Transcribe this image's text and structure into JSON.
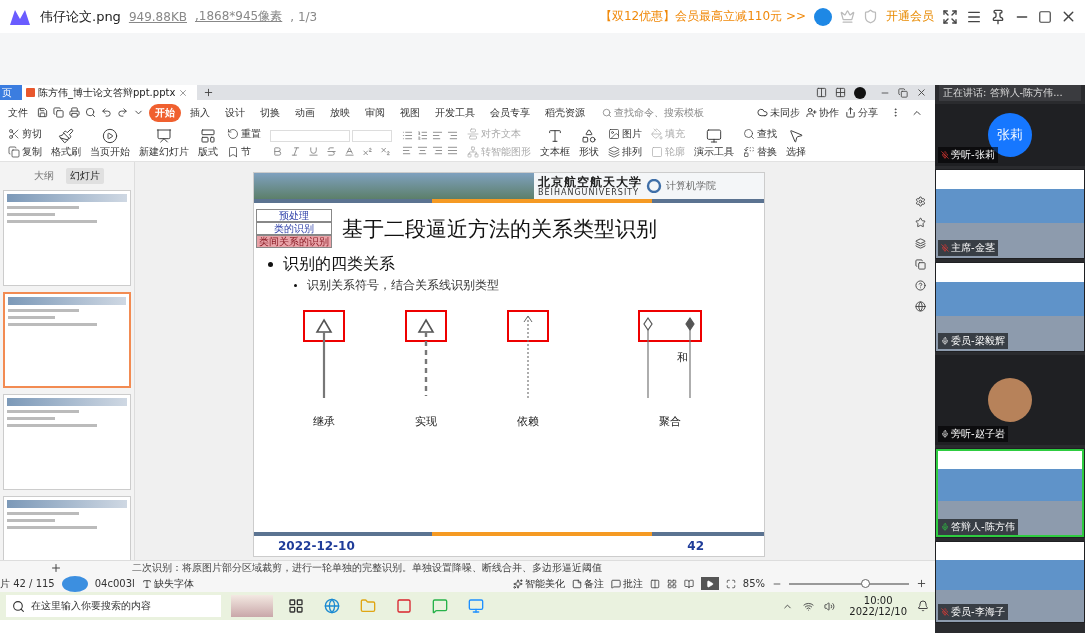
{
  "viewer": {
    "filename": "伟仔论文.png",
    "filesize": "949.88KB",
    "dimensions": ",1868*945像素",
    "position": ", 1/3",
    "promo": "【双12优惠】会员最高立减110元 >>",
    "vip_button": "开通会员"
  },
  "wps": {
    "home_tab": "页",
    "doc_tab": "陈方伟_博士论文答辩ppt.pptx",
    "menu": [
      {
        "label": "文件",
        "selected": false
      },
      {
        "label": "开始",
        "selected": true
      },
      {
        "label": "插入",
        "selected": false
      },
      {
        "label": "设计",
        "selected": false
      },
      {
        "label": "切换",
        "selected": false
      },
      {
        "label": "动画",
        "selected": false
      },
      {
        "label": "放映",
        "selected": false
      },
      {
        "label": "审阅",
        "selected": false
      },
      {
        "label": "视图",
        "selected": false
      },
      {
        "label": "开发工具",
        "selected": false
      },
      {
        "label": "会员专享",
        "selected": false
      },
      {
        "label": "稻壳资源",
        "selected": false
      }
    ],
    "search_placeholder": "查找命令、搜索模板",
    "actions": [
      "未同步",
      "协作",
      "分享"
    ],
    "ribbon": [
      {
        "kind": "stack",
        "items": [
          {
            "label": "剪切",
            "disabled": false
          },
          {
            "label": "复制",
            "disabled": false
          }
        ]
      },
      {
        "kind": "large",
        "label": "格式刷",
        "disabled": false
      },
      {
        "kind": "large",
        "label": "当页开始",
        "disabled": false
      },
      {
        "kind": "large",
        "label": "新建幻灯片",
        "disabled": false
      },
      {
        "kind": "large",
        "label": "版式",
        "disabled": false
      },
      {
        "kind": "stack",
        "items": [
          {
            "label": "重置",
            "disabled": false
          },
          {
            "label": "节",
            "disabled": false
          }
        ]
      },
      {
        "kind": "font"
      },
      {
        "kind": "paragraph"
      },
      {
        "kind": "stack",
        "items": [
          {
            "label": "对齐文本",
            "disabled": true
          },
          {
            "label": "转智能图形",
            "disabled": true
          }
        ]
      },
      {
        "kind": "large",
        "label": "文本框",
        "disabled": false
      },
      {
        "kind": "large",
        "label": "形状",
        "disabled": false
      },
      {
        "kind": "stack",
        "items": [
          {
            "label": "图片",
            "disabled": false
          },
          {
            "label": "排列",
            "disabled": false
          }
        ]
      },
      {
        "kind": "stack",
        "items": [
          {
            "label": "填充",
            "disabled": true
          },
          {
            "label": "轮廓",
            "disabled": true
          }
        ]
      },
      {
        "kind": "large",
        "label": "演示工具",
        "disabled": false
      },
      {
        "kind": "stack",
        "items": [
          {
            "label": "查找",
            "disabled": false
          },
          {
            "label": "替换",
            "disabled": false
          }
        ]
      },
      {
        "kind": "large",
        "label": "选择",
        "disabled": false
      }
    ],
    "panel_tabs": [
      {
        "label": "大纲",
        "selected": false
      },
      {
        "label": "幻灯片",
        "selected": true
      }
    ],
    "thumbnails": [
      {
        "selected": false
      },
      {
        "selected": true
      },
      {
        "selected": false
      },
      {
        "selected": false
      }
    ],
    "slide": {
      "school": "北京航空航天大学",
      "school_en": "BEIHANGUNIVERSITY",
      "college": "计算机学院",
      "nav": [
        {
          "label": "预处理",
          "selected": false
        },
        {
          "label": "类的识别",
          "selected": false
        },
        {
          "label": "类间关系的识别",
          "selected": true
        }
      ],
      "title": "基于二段逼近方法的关系类型识别",
      "bullet": "识别的四类关系",
      "sub_bullet": "识别关系符号，结合关系线识别类型",
      "figures": [
        {
          "kind": "solid-triangle",
          "label": "继承"
        },
        {
          "kind": "dashed-triangle",
          "label": "实现"
        },
        {
          "kind": "dotted-open",
          "label": "依赖"
        },
        {
          "kind": "diamond-pair",
          "label": "聚合",
          "between": "和"
        }
      ],
      "date": "2022-12-10",
      "page": "42"
    },
    "notes": "二次识别：将原图片部分区域裁剪，进行一轮单独的完整识别。单独设置降噪、断线合并、多边形逼近阈值",
    "status": {
      "slide_count": "片 42 / 115",
      "code": "04c003l",
      "missing_font": "缺失字体",
      "beautify": "智能美化",
      "notes": "备注",
      "comments": "批注",
      "zoom": "85%",
      "zoom_slider": {
        "level": 0.63
      }
    }
  },
  "taskbar": {
    "search_placeholder": "在这里输入你要搜索的内容",
    "time": "10:00",
    "date": "2022/12/10"
  },
  "meeting": {
    "speaking": "正在讲话: 答辩人-陈方伟...",
    "participants": [
      {
        "name": "旁听-张莉",
        "kind": "avatar",
        "avatar_text": "张莉",
        "muted": true,
        "speaking": false
      },
      {
        "name": "主席-金茎",
        "kind": "video",
        "muted": true,
        "speaking": false
      },
      {
        "name": "委员-梁毅辉",
        "kind": "video",
        "muted": false,
        "speaking": false
      },
      {
        "name": "旁听-赵子岩",
        "kind": "photo-avatar",
        "muted": false,
        "speaking": false
      },
      {
        "name": "答辩人-陈方伟",
        "kind": "video",
        "muted": false,
        "speaking": true
      },
      {
        "name": "委员-李海子",
        "kind": "video",
        "muted": true,
        "speaking": false
      }
    ]
  }
}
